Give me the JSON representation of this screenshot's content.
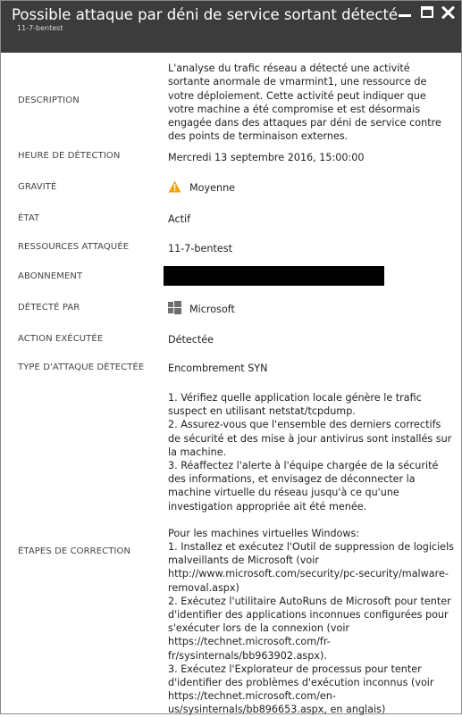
{
  "window": {
    "title": "Possible attaque par déni de service sortant détecté",
    "subtitle": "11-7-bentest"
  },
  "fields": {
    "description": {
      "label": "DESCRIPTION",
      "value": "L'analyse du trafic réseau a détecté une activité sortante anormale de vmarmint1, une ressource de votre déploiement. Cette activité peut indiquer que votre machine a été compromise et est désormais engagée dans des attaques par déni de service contre des points de terminaison externes."
    },
    "detection_time": {
      "label": "HEURE DE DÉTECTION",
      "value": "Mercredi 13 septembre 2016, 15:00:00"
    },
    "severity": {
      "label": "GRAVITÉ",
      "value": "Moyenne",
      "icon": "warning-icon",
      "icon_color": "#f0a30a"
    },
    "state": {
      "label": "ÉTAT",
      "value": "Actif"
    },
    "resources": {
      "label": "RESSOURCES ATTAQUÉE",
      "value": "11-7-bentest"
    },
    "subscription": {
      "label": "ABONNEMENT"
    },
    "detected_by": {
      "label": "DÉTECTÉ PAR",
      "value": "Microsoft",
      "icon": "windows-logo-icon"
    },
    "action": {
      "label": "ACTION EXÉCUTÉE",
      "value": "Détectée"
    },
    "attack_type": {
      "label": "TYPE D'ATTAQUE DÉTECTÉE",
      "value": "Encombrement SYN"
    },
    "remediation": {
      "label": "ÉTAPES DE CORRECTION",
      "steps": [
        "1. Vérifiez quelle application locale génère le trafic suspect en utilisant netstat/tcpdump.",
        "2. Assurez-vous que l'ensemble des derniers correctifs de sécurité et des mise à jour antivirus sont installés sur la machine.",
        "3. Réaffectez l'alerte à l'équipe chargée de la sécurité des informations, et envisagez de déconnecter la machine virtuelle du réseau jusqu'à ce qu'une investigation appropriée ait été menée."
      ],
      "windows_heading": "Pour les machines virtuelles Windows:",
      "windows_steps": [
        "1. Installez et exécutez l'Outil de suppression de logiciels malveillants de Microsoft (voir http://www.microsoft.com/security/pc-security/malware-removal.aspx)",
        "2. Exécutez l'utilitaire AutoRuns de Microsoft pour tenter d'identifier des applications inconnues configurées pour s'exécuter lors de la connexion (voir https://technet.microsoft.com/fr-fr/sysinternals/bb963902.aspx).",
        "3. Exécutez l'Explorateur de processus pour tenter d'identifier des problèmes d'exécution inconnus (voir https://technet.microsoft.com/en-us/sysinternals/bb896653.aspx, en anglais)"
      ]
    }
  }
}
